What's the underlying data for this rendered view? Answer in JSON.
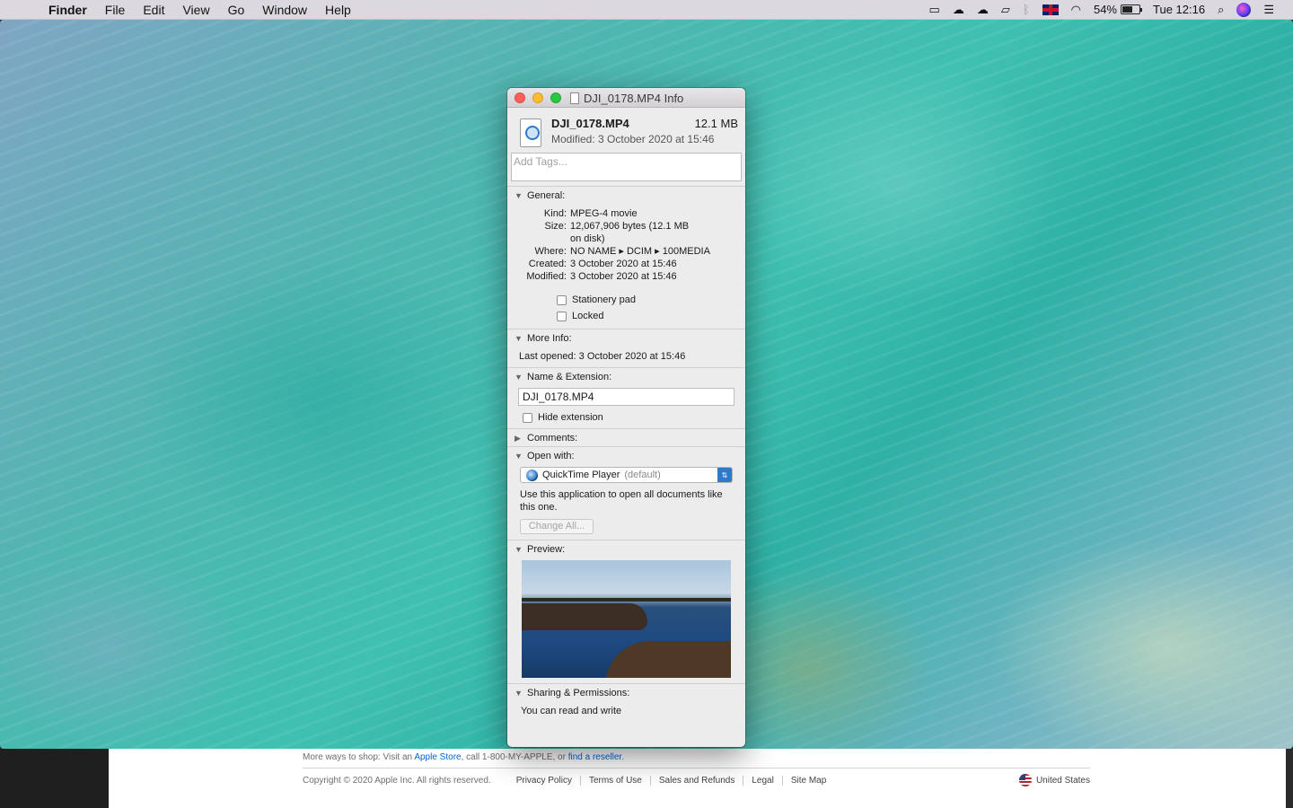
{
  "menubar": {
    "app_name": "Finder",
    "menus": [
      "File",
      "Edit",
      "View",
      "Go",
      "Window",
      "Help"
    ],
    "battery_percent": "54%",
    "clock": "Tue 12:16"
  },
  "background_page": {
    "shop_text": "More ways to shop: Visit an ",
    "apple_store": "Apple Store",
    "shop_text_2": ", call 1-800-MY-APPLE, or ",
    "reseller": "find a reseller",
    "shop_text_3": ".",
    "copyright": "Copyright © 2020 Apple Inc. All rights reserved.",
    "links": [
      "Privacy Policy",
      "Terms of Use",
      "Sales and Refunds",
      "Legal",
      "Site Map"
    ],
    "country": "United States"
  },
  "info_window": {
    "title": "DJI_0178.MP4 Info",
    "file_name": "DJI_0178.MP4",
    "file_size": "12.1 MB",
    "modified_line": "Modified: 3 October 2020 at 15:46",
    "tags_placeholder": "Add Tags...",
    "general": {
      "label": "General:",
      "kind_label": "Kind:",
      "kind": "MPEG-4 movie",
      "size_label": "Size:",
      "size": "12,067,906 bytes (12.1 MB",
      "size_2": "on disk)",
      "where_label": "Where:",
      "where": "NO NAME ▸ DCIM ▸ 100MEDIA",
      "created_label": "Created:",
      "created": "3 October 2020 at 15:46",
      "modified_label": "Modified:",
      "modified": "3 October 2020 at 15:46",
      "stationery": "Stationery pad",
      "locked": "Locked"
    },
    "more_info": {
      "label": "More Info:",
      "last_opened": "Last opened: 3 October 2020 at 15:46"
    },
    "name_ext": {
      "label": "Name & Extension:",
      "value": "DJI_0178.MP4",
      "hide_ext": "Hide extension"
    },
    "comments": {
      "label": "Comments:"
    },
    "open_with": {
      "label": "Open with:",
      "app": "QuickTime Player",
      "app_suffix": "(default)",
      "desc": "Use this application to open all documents like this one.",
      "change_all": "Change All..."
    },
    "preview": {
      "label": "Preview:"
    },
    "sharing": {
      "label": "Sharing & Permissions:",
      "text": "You can read and write"
    }
  }
}
